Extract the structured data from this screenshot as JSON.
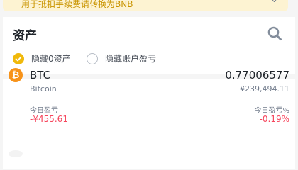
{
  "banner": {
    "text": "用于抵扣手续费请转换为BNB",
    "chevron_icon": "chevron-down-icon"
  },
  "assets": {
    "title": "资产",
    "search_icon": "search-icon",
    "options": [
      {
        "label": "隐藏0资产",
        "checked": true
      },
      {
        "label": "隐藏账户盈亏",
        "checked": false
      }
    ]
  },
  "holdings": [
    {
      "icon": "bitcoin-icon",
      "icon_glyph": "₿",
      "symbol": "BTC",
      "name": "Bitcoin",
      "amount": "0.77006577",
      "fiat_value": "¥239,494.11",
      "pnl_label": "今日盈亏",
      "pnl_value": "-¥455.61",
      "pnl_pct_label": "今日盈亏%",
      "pnl_pct_value": "-0.19%"
    }
  ],
  "colors": {
    "accent": "#f0b90b",
    "bitcoin": "#f7931a",
    "negative": "#f6465d",
    "secondary_text": "#707a8a"
  }
}
